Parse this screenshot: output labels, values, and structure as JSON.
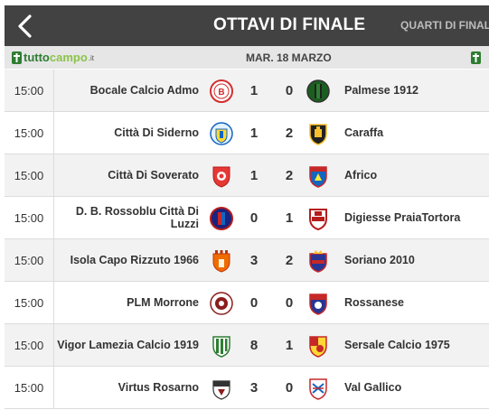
{
  "header": {
    "title": "OTTAVI DI FINALE",
    "next_tab": "QUARTI DI FINALE"
  },
  "subheader": {
    "logo": {
      "part1": "tutto",
      "part2": "campo",
      "part3": ".it"
    },
    "date": "MAR. 18 MARZO"
  },
  "colors": {
    "topbar": "#424242",
    "subbar": "#e6e6e6",
    "logo_dark": "#2e7d32",
    "logo_light": "#8bc34a"
  },
  "matches": [
    {
      "time": "15:00",
      "home": "Bocale Calcio Admo",
      "home_score": "1",
      "away_score": "0",
      "away": "Palmese 1912",
      "home_crest": "bocale-crest",
      "away_crest": "palmese-crest"
    },
    {
      "time": "15:00",
      "home": "Città Di Siderno",
      "home_score": "1",
      "away_score": "2",
      "away": "Caraffa",
      "home_crest": "siderno-crest",
      "away_crest": "caraffa-crest"
    },
    {
      "time": "15:00",
      "home": "Città Di Soverato",
      "home_score": "1",
      "away_score": "2",
      "away": "Africo",
      "home_crest": "soverato-crest",
      "away_crest": "africo-crest"
    },
    {
      "time": "15:00",
      "home": "D. B. Rossoblu Città Di Luzzi",
      "home_score": "0",
      "away_score": "1",
      "away": "Digiesse PraiaTortora",
      "home_crest": "luzzi-crest",
      "away_crest": "digiesse-crest"
    },
    {
      "time": "15:00",
      "home": "Isola Capo Rizzuto 1966",
      "home_score": "3",
      "away_score": "2",
      "away": "Soriano 2010",
      "home_crest": "isola-crest",
      "away_crest": "soriano-crest"
    },
    {
      "time": "15:00",
      "home": "PLM Morrone",
      "home_score": "0",
      "away_score": "0",
      "away": "Rossanese",
      "home_crest": "morrone-crest",
      "away_crest": "rossanese-crest"
    },
    {
      "time": "15:00",
      "home": "Vigor Lamezia Calcio 1919",
      "home_score": "8",
      "away_score": "1",
      "away": "Sersale Calcio 1975",
      "home_crest": "vigor-crest",
      "away_crest": "sersale-crest"
    },
    {
      "time": "15:00",
      "home": "Virtus Rosarno",
      "home_score": "3",
      "away_score": "0",
      "away": "Val Gallico",
      "home_crest": "rosarno-crest",
      "away_crest": "gallico-crest"
    }
  ]
}
